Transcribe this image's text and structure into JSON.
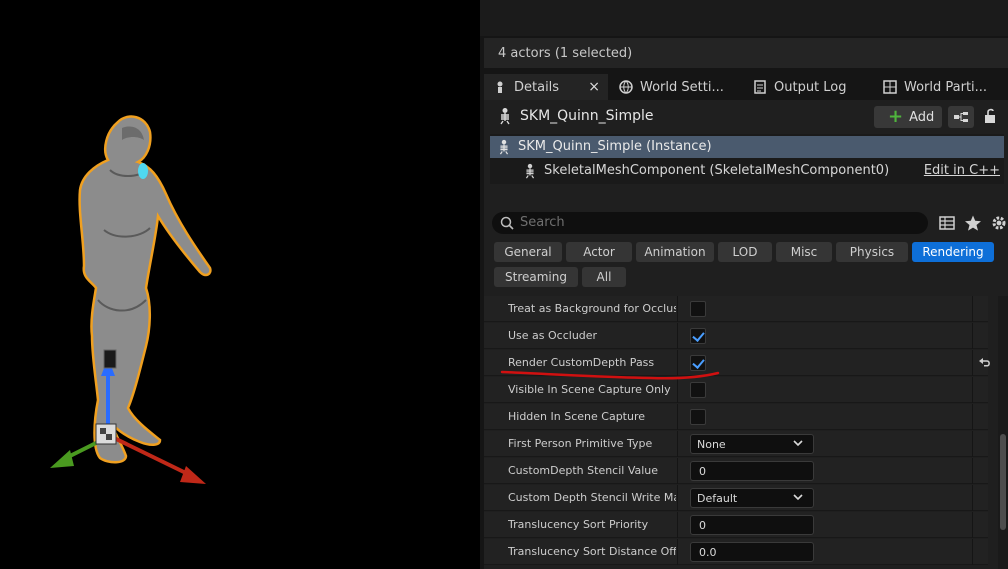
{
  "outliner": {
    "status": "4 actors (1 selected)"
  },
  "tabs": [
    {
      "label": "Details",
      "icon": "details-icon",
      "active": true
    },
    {
      "label": "World Setti...",
      "icon": "globe-icon",
      "active": false
    },
    {
      "label": "Output Log",
      "icon": "output-log-icon",
      "active": false
    },
    {
      "label": "World Parti...",
      "icon": "world-partition-icon",
      "active": false
    }
  ],
  "tab_close": "×",
  "details": {
    "actor_name": "SKM_Quinn_Simple",
    "add_label": "Add",
    "components": {
      "root": "SKM_Quinn_Simple (Instance)",
      "child": "SkeletalMeshComponent (SkeletalMeshComponent0)",
      "edit_cpp": "Edit in C++"
    },
    "search_placeholder": "Search",
    "categories": [
      {
        "label": "General",
        "active": false
      },
      {
        "label": "Actor",
        "active": false
      },
      {
        "label": "Animation",
        "active": false
      },
      {
        "label": "LOD",
        "active": false
      },
      {
        "label": "Misc",
        "active": false
      },
      {
        "label": "Physics",
        "active": false
      },
      {
        "label": "Rendering",
        "active": true
      },
      {
        "label": "Streaming",
        "active": false
      },
      {
        "label": "All",
        "active": false
      }
    ],
    "properties": [
      {
        "label": "Treat as Background for Occlus...",
        "type": "checkbox",
        "checked": false
      },
      {
        "label": "Use as Occluder",
        "type": "checkbox",
        "checked": true
      },
      {
        "label": "Render CustomDepth Pass",
        "type": "checkbox",
        "checked": true,
        "modified": true
      },
      {
        "label": "Visible In Scene Capture Only",
        "type": "checkbox",
        "checked": false
      },
      {
        "label": "Hidden In Scene Capture",
        "type": "checkbox",
        "checked": false
      },
      {
        "label": "First Person Primitive Type",
        "type": "dropdown",
        "value": "None"
      },
      {
        "label": "CustomDepth Stencil Value",
        "type": "number",
        "value": "0"
      },
      {
        "label": "Custom Depth Stencil Write Mask",
        "type": "dropdown",
        "value": "Default"
      },
      {
        "label": "Translucency Sort Priority",
        "type": "number",
        "value": "0"
      },
      {
        "label": "Translucency Sort Distance Off...",
        "type": "number",
        "value": "0.0"
      }
    ]
  },
  "colors": {
    "accent": "#0e6fd8",
    "check": "#4a9eff",
    "selection_outline": "#f0a020",
    "annotation": "#d01010"
  }
}
